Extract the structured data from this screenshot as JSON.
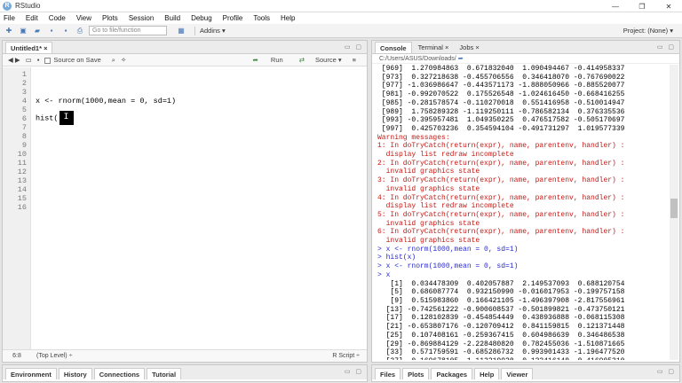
{
  "window": {
    "title": "RStudio",
    "minimize": "—",
    "restore": "❐",
    "close": "✕"
  },
  "menu": [
    "File",
    "Edit",
    "Code",
    "View",
    "Plots",
    "Session",
    "Build",
    "Debug",
    "Profile",
    "Tools",
    "Help"
  ],
  "toolbar": {
    "goto_placeholder": "Go to file/function",
    "addins": "Addins ▾",
    "project": "Project: (None) ▾"
  },
  "editor": {
    "tab": "Untitled1* ×",
    "source_on_save": "Source on Save",
    "run": "Run",
    "source": "Source ▾",
    "lines": [
      "1",
      "2",
      "3",
      "4",
      "5",
      "6",
      "7",
      "8",
      "9",
      "10",
      "11",
      "12",
      "13",
      "14",
      "15",
      "16"
    ],
    "code_line4": "x <- rnorm(1000,mean = 0, sd=1)",
    "code_line6": "hist(",
    "status_pos": "6:8",
    "status_level": "(Top Level) ÷",
    "status_type": "R Script ÷"
  },
  "console": {
    "tabs": [
      "Console",
      "Terminal ×",
      "Jobs ×"
    ],
    "path": "C:/Users/ASUS/Downloads/",
    "lines": [
      {
        "t": "o",
        "s": " [969]  1.270984863  0.671832040  1.090494467 -0.414958337"
      },
      {
        "t": "o",
        "s": " [973]  0.327218638 -0.455706556  0.346418070 -0.767690022"
      },
      {
        "t": "o",
        "s": " [977] -1.036986647 -0.443571173 -1.888050966 -0.885520077"
      },
      {
        "t": "o",
        "s": " [981] -0.992070522  0.175526548 -1.024616450 -0.668416255"
      },
      {
        "t": "o",
        "s": " [985] -0.281578574 -0.110270018  0.551416958 -0.510014947"
      },
      {
        "t": "o",
        "s": " [989]  1.758289328 -1.119250111 -0.786582134  0.376335536"
      },
      {
        "t": "o",
        "s": " [993] -0.395957481  1.049350225  0.476517582 -0.505170697"
      },
      {
        "t": "o",
        "s": " [997]  0.425703236  0.354594104 -0.491731297  1.019577339"
      },
      {
        "t": "w",
        "s": "Warning messages:"
      },
      {
        "t": "w",
        "s": "1: In doTryCatch(return(expr), name, parentenv, handler) :"
      },
      {
        "t": "w",
        "s": "  display list redraw incomplete"
      },
      {
        "t": "w",
        "s": "2: In doTryCatch(return(expr), name, parentenv, handler) :"
      },
      {
        "t": "w",
        "s": "  invalid graphics state"
      },
      {
        "t": "w",
        "s": "3: In doTryCatch(return(expr), name, parentenv, handler) :"
      },
      {
        "t": "w",
        "s": "  invalid graphics state"
      },
      {
        "t": "w",
        "s": "4: In doTryCatch(return(expr), name, parentenv, handler) :"
      },
      {
        "t": "w",
        "s": "  display list redraw incomplete"
      },
      {
        "t": "w",
        "s": "5: In doTryCatch(return(expr), name, parentenv, handler) :"
      },
      {
        "t": "w",
        "s": "  invalid graphics state"
      },
      {
        "t": "w",
        "s": "6: In doTryCatch(return(expr), name, parentenv, handler) :"
      },
      {
        "t": "w",
        "s": "  invalid graphics state"
      },
      {
        "t": "i",
        "s": "> x <- rnorm(1000,mean = 0, sd=1)"
      },
      {
        "t": "i",
        "s": "> hist(x)"
      },
      {
        "t": "i",
        "s": "> x <- rnorm(1000,mean = 0, sd=1)"
      },
      {
        "t": "i",
        "s": "> x"
      },
      {
        "t": "o",
        "s": "   [1]  0.034478309  0.402057887  2.149537093  0.688120754"
      },
      {
        "t": "o",
        "s": "   [5]  0.686087774  0.932150990 -0.016017953 -0.199757158"
      },
      {
        "t": "o",
        "s": "   [9]  0.515983860  0.166421105 -1.496397908 -2.817556961"
      },
      {
        "t": "o",
        "s": "  [13] -0.742561222 -0.900608537 -0.501899821 -0.473750121"
      },
      {
        "t": "o",
        "s": "  [17]  0.128102839 -0.454854449  0.438936888 -0.068115308"
      },
      {
        "t": "o",
        "s": "  [21] -0.653807176 -0.120709412  0.841159815  0.121371448"
      },
      {
        "t": "o",
        "s": "  [25]  0.107408161 -0.259367415  0.604986639  0.346486538"
      },
      {
        "t": "o",
        "s": "  [29] -0.869884129 -2.228480820  0.782455036 -1.510871665"
      },
      {
        "t": "o",
        "s": "  [33]  0.571759591 -0.685286732  0.993901433 -1.196477520"
      },
      {
        "t": "o",
        "s": "  [37] -0.169678105 -1.112219930 -0.133416140  0.416905310"
      }
    ]
  },
  "bottom_left_tabs": [
    "Environment",
    "History",
    "Connections",
    "Tutorial"
  ],
  "bottom_right_tabs": [
    "Files",
    "Plots",
    "Packages",
    "Help",
    "Viewer"
  ]
}
